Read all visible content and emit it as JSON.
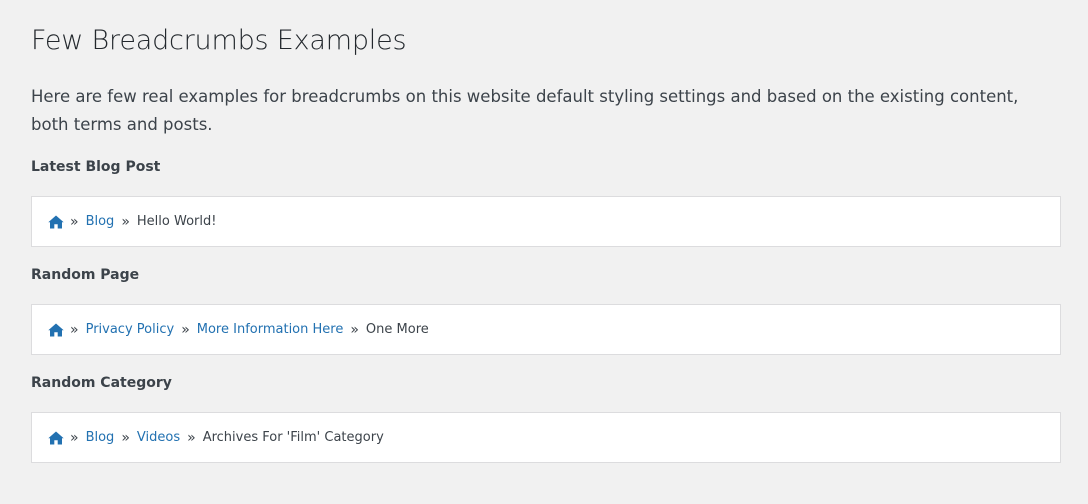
{
  "page": {
    "title": "Few Breadcrumbs Examples",
    "intro": "Here are few real examples for breadcrumbs on this website default styling settings and based on the existing content, both terms and posts."
  },
  "sections": [
    {
      "title": "Latest Blog Post",
      "links": [
        "Blog"
      ],
      "current": "Hello World!"
    },
    {
      "title": "Random Page",
      "links": [
        "Privacy Policy",
        "More Information Here"
      ],
      "current": "One More"
    },
    {
      "title": "Random Category",
      "links": [
        "Blog",
        "Videos"
      ],
      "current": "Archives For 'Film' Category"
    }
  ],
  "separator": "»",
  "icons": {
    "home": "home-icon"
  },
  "colors": {
    "link": "#2271b1",
    "background": "#f1f1f1",
    "panel": "#ffffff"
  }
}
